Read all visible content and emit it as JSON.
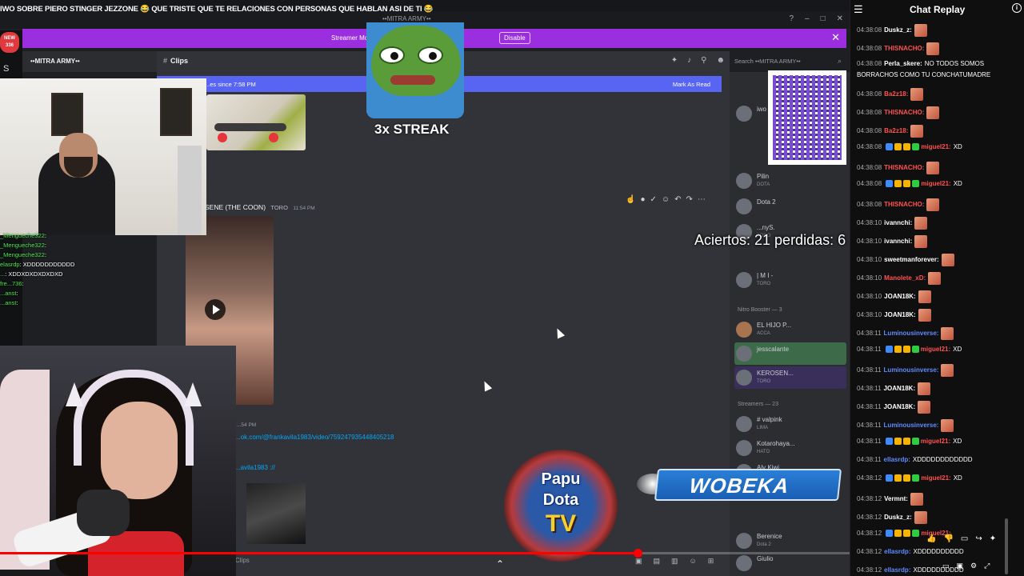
{
  "video": {
    "title": "IWO SOBRE PIERO STINGER JEZZONE 😂 QUE TRISTE QUE TE RELACIONES CON PERSONAS QUE HABLAN ASI DE TI 😂",
    "progress_pct": 75
  },
  "discord": {
    "window_title": "••MITRA ARMY••",
    "streamer_banner": "Streamer Mode is ... been truncated.",
    "disable_label": "Disable",
    "new_badge": "NEW\n336",
    "server_name": "••MITRA ARMY••",
    "channel": {
      "hash": "#",
      "name": "Clips"
    },
    "search_placeholder": "Search ••MITRA ARMY••",
    "new_messages": "...es since 7:58 PM",
    "mark_as_read": "Mark As Read",
    "message": {
      "author": "SENE (THE COON)",
      "role": "TORO",
      "time": "11:54 PM"
    },
    "link_time": "...54 PM",
    "link1": "...ok.com/@frankavila1983/video/759247935448405218",
    "link2": "...avila1983 ://",
    "bottom_channel": "Clips",
    "members": [
      {
        "name": "iwo",
        "sub": ""
      },
      {
        "name": "Pilin",
        "sub": "DOTA"
      },
      {
        "name": "Dota 2",
        "sub": ""
      },
      {
        "name": "...nyS.",
        "sub": "TORO"
      },
      {
        "name": "| M I -",
        "sub": "TORO"
      }
    ],
    "nitro_header": "Nitro Booster — 3",
    "boosters": [
      {
        "name": "EL HIJO P...",
        "sub": "ACCA"
      },
      {
        "name": "jesscalante",
        "sub": ""
      },
      {
        "name": "KEROSEN...",
        "sub": "TORO"
      }
    ],
    "streamers_header": "Streamers — 23",
    "streamers": [
      {
        "name": "# valpink",
        "sub": "LIMA"
      },
      {
        "name": "Kotarohaya...",
        "sub": "HATO"
      },
      {
        "name": "Aly Kiwi...",
        "sub": ""
      },
      {
        "name": "Berenice",
        "sub": "Dota 2"
      },
      {
        "name": "Giulio",
        "sub": ""
      }
    ]
  },
  "overlays": {
    "stat": "Aciertos: 21 perdidas: 6",
    "streak": "3x STREAK",
    "papu_line1": "Papu",
    "papu_line2": "Dota",
    "papu_line3": "TV",
    "wobeka": "WOBEKA"
  },
  "obs_chat": [
    {
      "user": "_Mengueche322",
      "msg": ":"
    },
    {
      "user": "_Mengueche322",
      "msg": ":"
    },
    {
      "user": "_Mengueche322",
      "msg": ":"
    },
    {
      "user": "elasrdp",
      "msg": ": XDDDDDDDDDDD"
    },
    {
      "user": "...",
      "msg": ": XDDXDXDXDXDXD"
    },
    {
      "user": "fre...736",
      "msg": ":"
    },
    {
      "user": "...anst",
      "msg": ":"
    },
    {
      "user": "...anst",
      "msg": ":"
    }
  ],
  "chat": {
    "title": "Chat Replay",
    "messages": [
      {
        "time": "04:38:08",
        "name": "Duskz_z:",
        "color": "white",
        "msg": "",
        "sticker": true
      },
      {
        "time": "04:38:08",
        "name": "THISNACHO:",
        "color": "red",
        "msg": "",
        "sticker": true
      },
      {
        "time": "04:38:08",
        "name": "Perla_skere:",
        "color": "white",
        "msg": "NO TODOS SOMOS BORRACHOS COMO TU CONCHATUMADRE",
        "sticker": false,
        "two": true
      },
      {
        "time": "04:38:08",
        "name": "Ba2z18:",
        "color": "red",
        "msg": "",
        "sticker": true
      },
      {
        "time": "04:38:08",
        "name": "THISNACHO:",
        "color": "red",
        "msg": "",
        "sticker": true
      },
      {
        "time": "04:38:08",
        "name": "Ba2z18:",
        "color": "red",
        "msg": "",
        "sticker": true
      },
      {
        "time": "04:38:08",
        "name": "miguel21:",
        "color": "red",
        "msg": "XD",
        "sticker": false,
        "badges": true
      },
      {
        "time": "04:38:08",
        "name": "THISNACHO:",
        "color": "red",
        "msg": "",
        "sticker": true
      },
      {
        "time": "04:38:08",
        "name": "miguel21:",
        "color": "red",
        "msg": "XD",
        "sticker": false,
        "badges": true
      },
      {
        "time": "04:38:08",
        "name": "THISNACHO:",
        "color": "red",
        "msg": "",
        "sticker": true
      },
      {
        "time": "04:38:10",
        "name": "ivannchi:",
        "color": "white",
        "msg": "",
        "sticker": true
      },
      {
        "time": "04:38:10",
        "name": "ivannchi:",
        "color": "white",
        "msg": "",
        "sticker": true
      },
      {
        "time": "04:38:10",
        "name": "sweetmanforever:",
        "color": "white",
        "msg": "",
        "sticker": true
      },
      {
        "time": "04:38:10",
        "name": "Manolete_xD:",
        "color": "red",
        "msg": "",
        "sticker": true
      },
      {
        "time": "04:38:10",
        "name": "JOAN18K:",
        "color": "white",
        "msg": "",
        "sticker": true
      },
      {
        "time": "04:38:10",
        "name": "JOAN18K:",
        "color": "white",
        "msg": "",
        "sticker": true
      },
      {
        "time": "04:38:11",
        "name": "Luminousinverse:",
        "color": "blue",
        "msg": "",
        "sticker": true
      },
      {
        "time": "04:38:11",
        "name": "miguel21:",
        "color": "red",
        "msg": "XD",
        "sticker": false,
        "badges": true
      },
      {
        "time": "04:38:11",
        "name": "Luminousinverse:",
        "color": "blue",
        "msg": "",
        "sticker": true
      },
      {
        "time": "04:38:11",
        "name": "JOAN18K:",
        "color": "white",
        "msg": "",
        "sticker": true
      },
      {
        "time": "04:38:11",
        "name": "JOAN18K:",
        "color": "white",
        "msg": "",
        "sticker": true
      },
      {
        "time": "04:38:11",
        "name": "Luminousinverse:",
        "color": "blue",
        "msg": "",
        "sticker": true
      },
      {
        "time": "04:38:11",
        "name": "miguel21:",
        "color": "red",
        "msg": "XD",
        "sticker": false,
        "badges": true
      },
      {
        "time": "04:38:11",
        "name": "ellasrdp:",
        "color": "blue",
        "msg": "XDDDDDDDDDDDD",
        "sticker": false
      },
      {
        "time": "04:38:12",
        "name": "miguel21:",
        "color": "red",
        "msg": "XD",
        "sticker": false,
        "badges": true
      },
      {
        "time": "04:38:12",
        "name": "Vermnt:",
        "color": "white",
        "msg": "",
        "sticker": true
      },
      {
        "time": "04:38:12",
        "name": "Duskz_z:",
        "color": "white",
        "msg": "",
        "sticker": true
      },
      {
        "time": "04:38:12",
        "name": "miguel21:",
        "color": "red",
        "msg": "",
        "sticker": false,
        "badges": true
      },
      {
        "time": "04:38:12",
        "name": "ellasrdp:",
        "color": "blue",
        "msg": "XDDDDDDDDDD",
        "sticker": false
      },
      {
        "time": "04:38:12",
        "name": "ellasrdp:",
        "color": "blue",
        "msg": "XDDDDDDDDDD",
        "sticker": false
      }
    ]
  }
}
